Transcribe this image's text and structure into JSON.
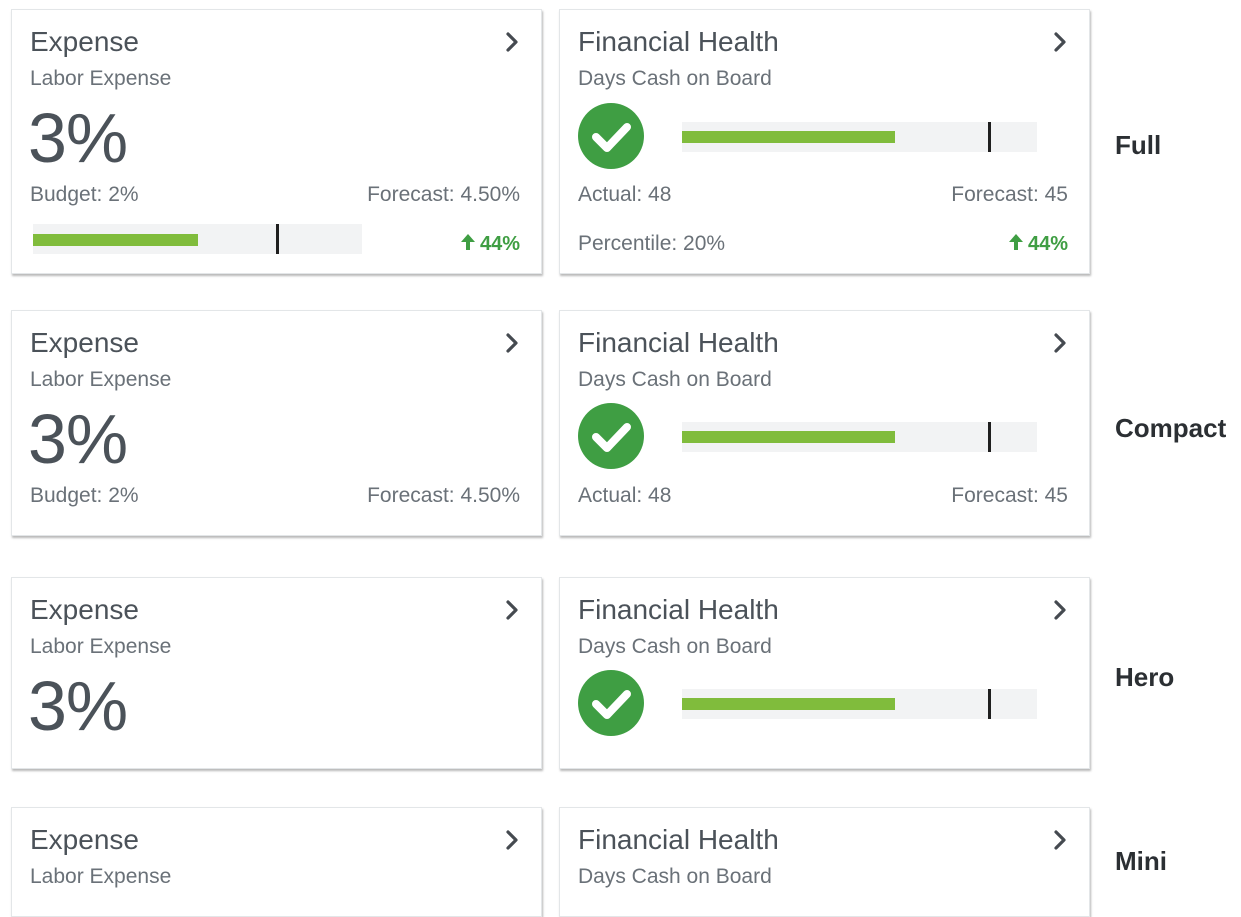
{
  "colors": {
    "accent_green": "#80bc3c",
    "status_green": "#3f9e43",
    "text": "#4b5259"
  },
  "expense_card": {
    "title": "Expense",
    "subtitle": "Labor Expense",
    "value": "3%",
    "budget": "Budget: 2%",
    "forecast": "Forecast: 4.50%",
    "trend": "44%",
    "trend_icon": "arrow-up-icon",
    "bar": {
      "fill_fraction": 0.5,
      "marker_fraction": 0.74
    }
  },
  "health_card": {
    "title": "Financial Health",
    "subtitle": "Days Cash on Board",
    "status_icon": "checkmark-circle-icon",
    "actual": "Actual: 48",
    "forecast": "Forecast: 45",
    "percentile": "Percentile: 20%",
    "trend": "44%",
    "trend_icon": "arrow-up-icon",
    "bar": {
      "fill_fraction": 0.6,
      "marker_fraction": 0.87
    }
  },
  "variants": [
    {
      "label": "Full"
    },
    {
      "label": "Compact"
    },
    {
      "label": "Hero"
    },
    {
      "label": "Mini"
    }
  ]
}
